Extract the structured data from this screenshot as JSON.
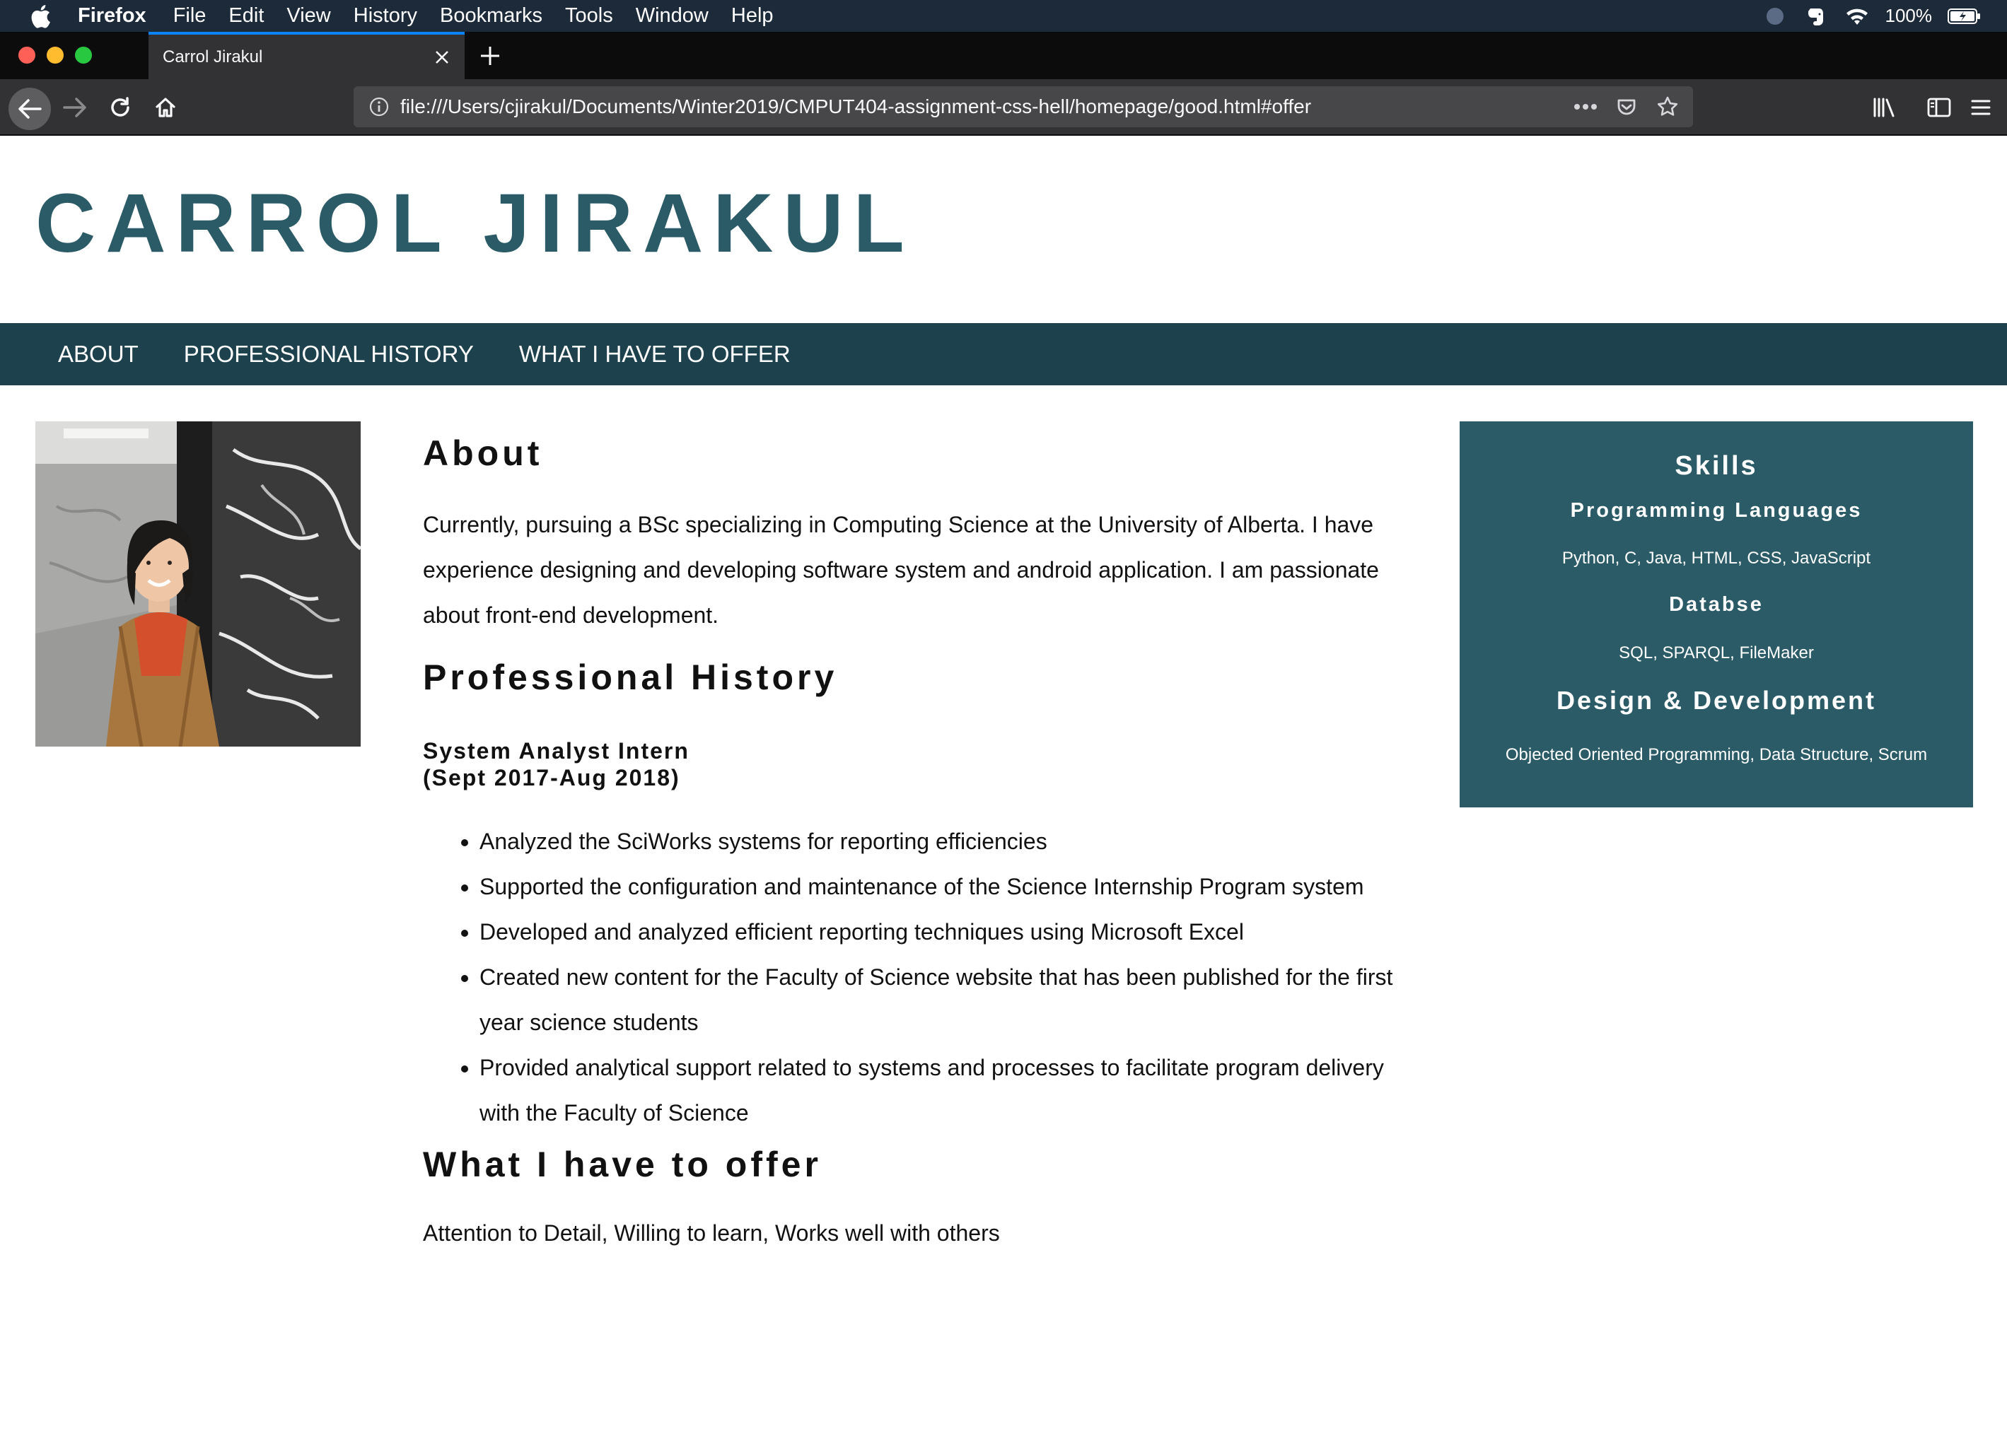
{
  "menubar": {
    "app_name": "Firefox",
    "items": [
      "File",
      "Edit",
      "View",
      "History",
      "Bookmarks",
      "Tools",
      "Window",
      "Help"
    ],
    "battery_percent": "100%"
  },
  "tab": {
    "title": "Carrol Jirakul"
  },
  "urlbar": {
    "url": "file:///Users/cjirakul/Documents/Winter2019/CMPUT404-assignment-css-hell/homepage/good.html#offer"
  },
  "site": {
    "title": "CARROL JIRAKUL",
    "nav": [
      "ABOUT",
      "PROFESSIONAL HISTORY",
      "WHAT I HAVE TO OFFER"
    ]
  },
  "about": {
    "heading": "About",
    "text": "Currently, pursuing a BSc specializing in Computing Science at the University of Alberta. I have experience designing and developing software system and android application. I am passionate about front-end development."
  },
  "history": {
    "heading": "Professional History",
    "job_title": "System Analyst Intern",
    "job_dates": "(Sept 2017-Aug 2018)",
    "duties": [
      "Analyzed the SciWorks systems for reporting efficiencies",
      "Supported the configuration and maintenance of the Science Internship Program system",
      "Developed and analyzed efficient reporting techniques using Microsoft Excel",
      "Created new content for the Faculty of Science website that has been published for the first year science students",
      "Provided analytical support related to systems and processes to facilitate program delivery with the Faculty of Science"
    ]
  },
  "offer": {
    "heading": "What I have to offer",
    "text": "Attention to Detail, Willing to learn, Works well with others"
  },
  "skills": {
    "title": "Skills",
    "programming_heading": "Programming Languages",
    "programming_text": "Python, C, Java, HTML, CSS, JavaScript",
    "database_heading": "Databse",
    "database_text": "SQL, SPARQL, FileMaker",
    "design_heading": "Design & Development",
    "design_text": "Objected Oriented Programming, Data Structure, Scrum"
  },
  "colors": {
    "accent": "#2a5b66",
    "nav_bg": "#1e424d",
    "menubar_bg": "#1d2a3a",
    "browser_toolbar": "#323234"
  }
}
